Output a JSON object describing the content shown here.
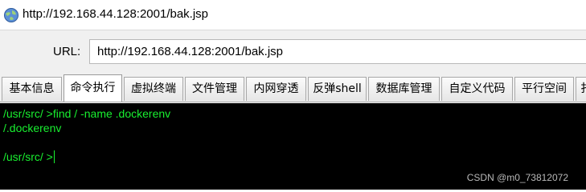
{
  "window": {
    "title": "http://192.168.44.128:2001/bak.jsp",
    "icon": "globe-icon"
  },
  "address": {
    "label": "URL:",
    "value": "http://192.168.44.128:2001/bak.jsp"
  },
  "tabs": [
    {
      "label": "基本信息",
      "active": false
    },
    {
      "label": "命令执行",
      "active": true
    },
    {
      "label": "虚拟终端",
      "active": false
    },
    {
      "label": "文件管理",
      "active": false
    },
    {
      "label": "内网穿透",
      "active": false
    },
    {
      "label": "反弹shell",
      "active": false
    },
    {
      "label": "数据库管理",
      "active": false
    },
    {
      "label": "自定义代码",
      "active": false
    },
    {
      "label": "平行空间",
      "active": false
    },
    {
      "label": "扌",
      "active": false
    }
  ],
  "terminal": {
    "lines": [
      "/usr/src/ >find / -name .dockerenv",
      "/.dockerenv",
      "",
      "/usr/src/ >"
    ],
    "text_color": "#19f030",
    "background": "#000000"
  },
  "watermark": "CSDN @m0_73812072"
}
